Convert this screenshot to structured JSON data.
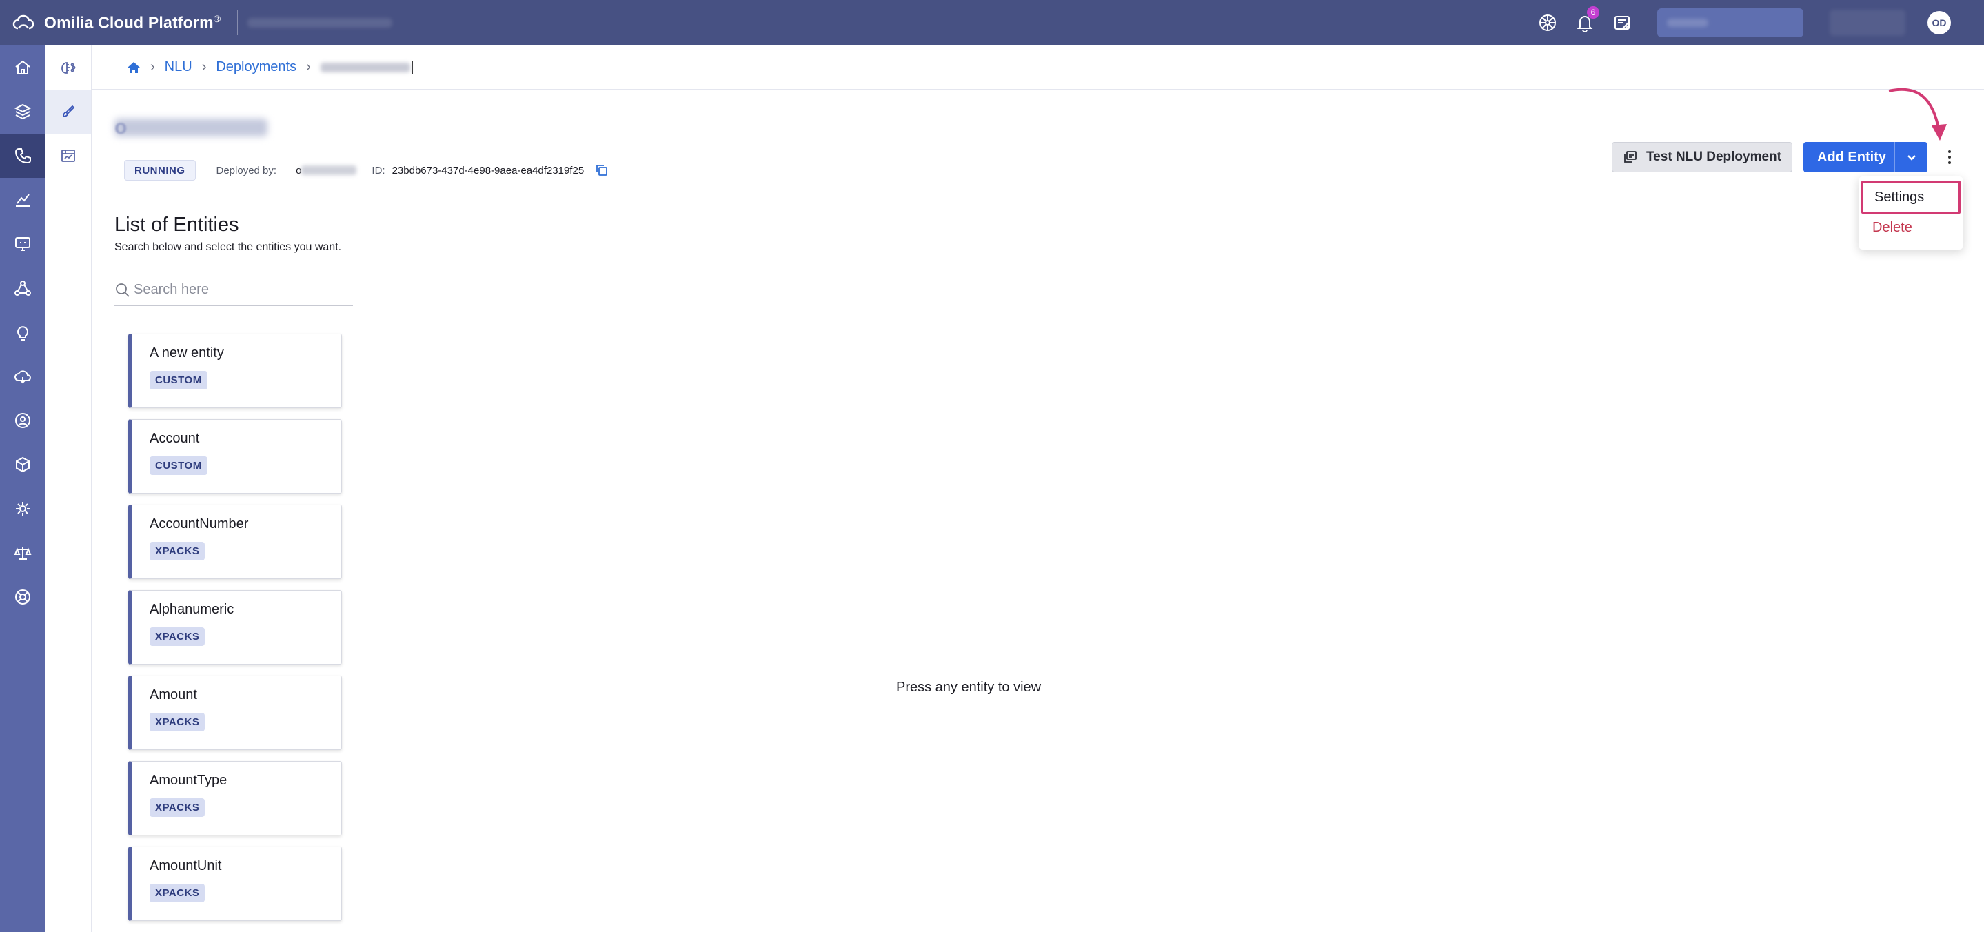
{
  "app": {
    "brand": "Omilia Cloud Platform",
    "brand_mark": "®",
    "notification_count": "6",
    "user_initials": "OD"
  },
  "breadcrumb": {
    "items": [
      "NLU",
      "Deployments"
    ]
  },
  "deployment": {
    "title_initial": "o",
    "status": "RUNNING",
    "deployed_by_label": "Deployed by:",
    "deployed_by_initial": "o",
    "id_label": "ID:",
    "id_value": "23bdb673-437d-4e98-9aea-ea4df2319f25"
  },
  "actions": {
    "test_label": "Test NLU Deployment",
    "add_label": "Add Entity"
  },
  "menu": {
    "items": [
      "Settings",
      "Delete"
    ]
  },
  "entities": {
    "title": "List of Entities",
    "subtitle": "Search below and select the entities you want.",
    "search_placeholder": "Search here",
    "items": [
      {
        "name": "A new entity",
        "tag": "CUSTOM"
      },
      {
        "name": "Account",
        "tag": "CUSTOM"
      },
      {
        "name": "AccountNumber",
        "tag": "XPACKS"
      },
      {
        "name": "Alphanumeric",
        "tag": "XPACKS"
      },
      {
        "name": "Amount",
        "tag": "XPACKS"
      },
      {
        "name": "AmountType",
        "tag": "XPACKS"
      },
      {
        "name": "AmountUnit",
        "tag": "XPACKS"
      }
    ]
  },
  "detail": {
    "empty_message": "Press any entity to view"
  },
  "colors": {
    "topbar": "#475183",
    "rail": "#5a67a7",
    "primary": "#2e68e5",
    "annotation": "#d23a73",
    "danger": "#c4374f"
  }
}
